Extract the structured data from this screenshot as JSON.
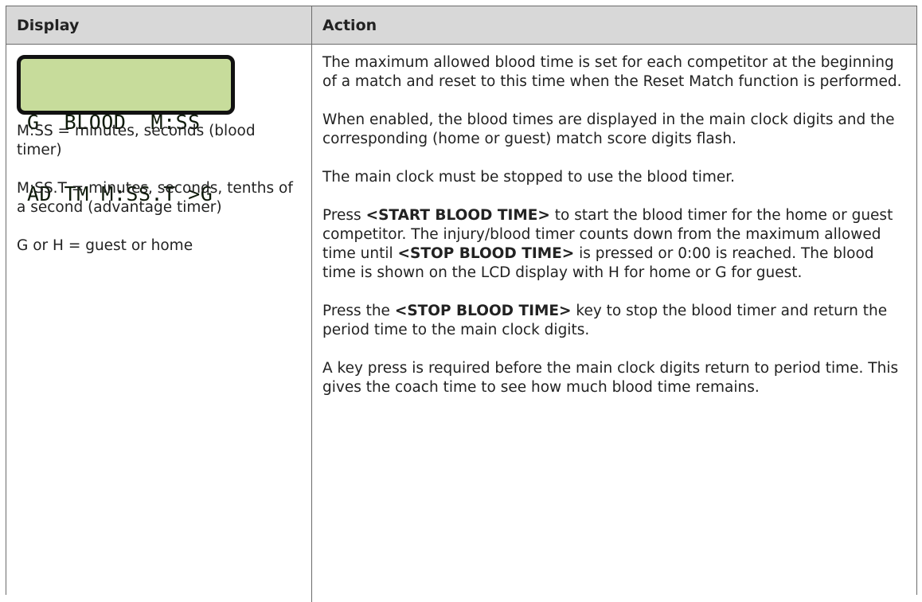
{
  "table": {
    "headers": {
      "display": "Display",
      "action": "Action"
    },
    "lcd": {
      "line1": "G  BLOOD  M:SS",
      "line2": "AD TM M:SS.T >G"
    },
    "legend": [
      "M:SS = minutes, seconds (blood timer)",
      "M:SS.T = minutes, seconds, tenths of a second (advantage timer)",
      "G or H = guest or home"
    ],
    "action_paragraphs": {
      "p1": "The maximum allowed blood time is set for each competitor at the beginning of a match and reset to this time when the Reset Match function is performed.",
      "p2": "When enabled, the blood times are displayed in the main clock digits and the corresponding (home or guest) match score digits flash.",
      "p3": "The main clock must be stopped to use the blood timer.",
      "p4_a": "Press ",
      "p4_key1": "<START BLOOD TIME>",
      "p4_b": " to start the blood timer for the home or guest competitor. The injury/blood timer counts down from the maximum allowed time until ",
      "p4_key2": "<STOP BLOOD TIME>",
      "p4_c": " is pressed or 0:00 is reached. The blood time is shown on the LCD display with H for home or G for guest.",
      "p5_a": "Press the ",
      "p5_key": "<STOP BLOOD TIME>",
      "p5_b": " key to stop the blood timer and return the period time to the main clock digits.",
      "p6": "A key press is required before the main clock digits return to period time. This gives the coach time to see how much blood time remains."
    },
    "colors": {
      "header_bg": "#d8d8d8",
      "lcd_bg": "#c7dc9b",
      "border": "#6b6b6b"
    }
  }
}
